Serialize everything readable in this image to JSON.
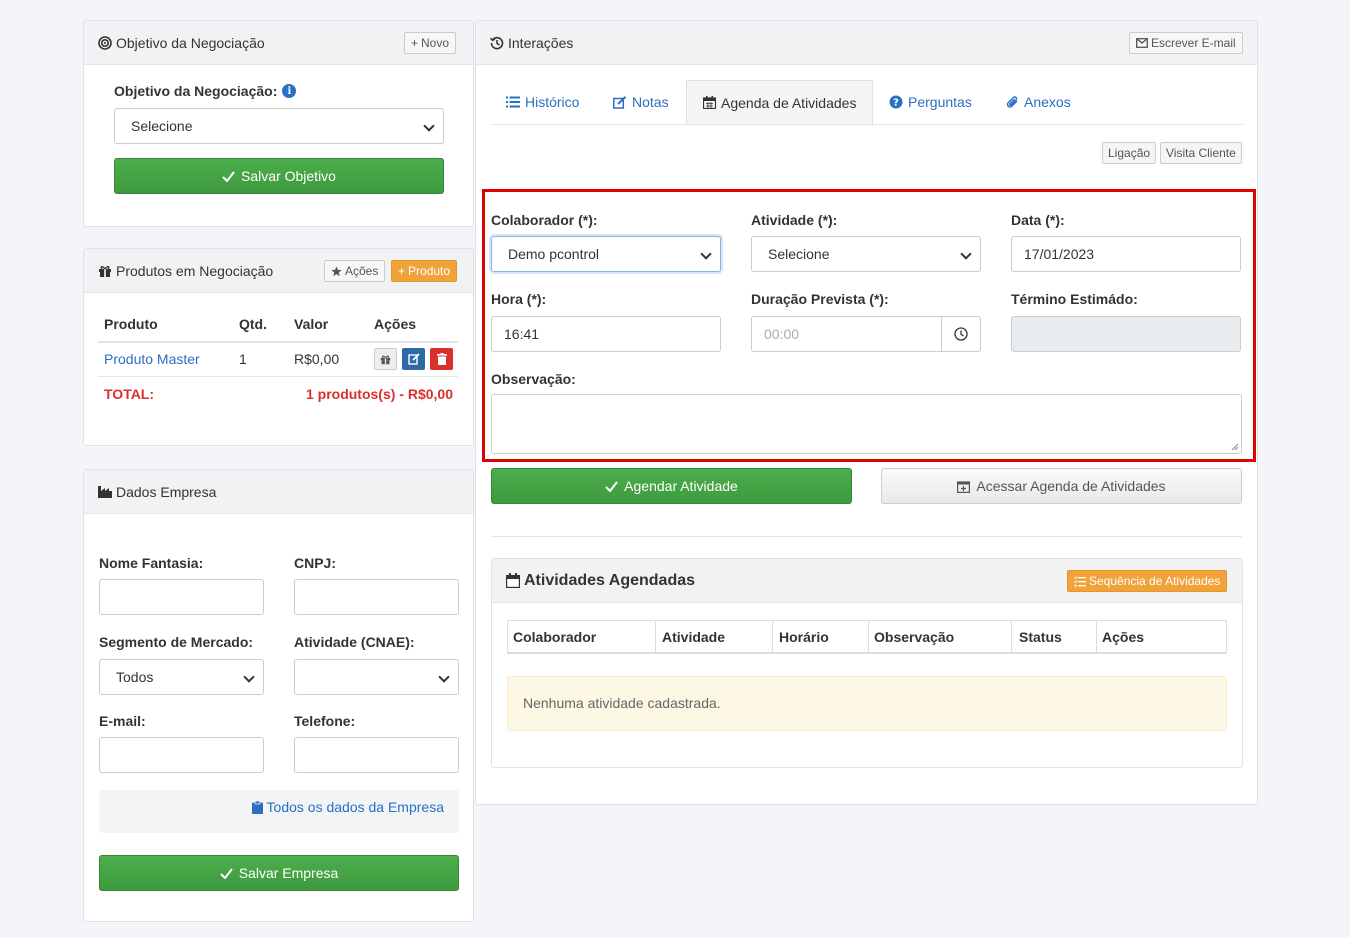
{
  "objetivo": {
    "title": "Objetivo da Negociação",
    "novo_label": "Novo",
    "field_label": "Objetivo da Negociação:",
    "select_value": "Selecione",
    "save_label": "Salvar Objetivo"
  },
  "produtos": {
    "title": "Produtos em Negociação",
    "acoes_label": "Ações",
    "produto_label": "Produto",
    "columns": [
      "Produto",
      "Qtd.",
      "Valor",
      "Ações"
    ],
    "rows": [
      {
        "produto": "Produto Master",
        "qtd": "1",
        "valor": "R$0,00"
      }
    ],
    "total_label": "TOTAL:",
    "total_value": "1 produtos(s) - R$0,00"
  },
  "empresa": {
    "title": "Dados Empresa",
    "nome_fantasia_label": "Nome Fantasia:",
    "cnpj_label": "CNPJ:",
    "segmento_label": "Segmento de Mercado:",
    "segmento_value": "Todos",
    "atividade_label": "Atividade (CNAE):",
    "email_label": "E-mail:",
    "telefone_label": "Telefone:",
    "todos_dados_link": "Todos os dados da Empresa",
    "save_label": "Salvar Empresa"
  },
  "interacoes": {
    "title": "Interações",
    "escrever_email": "Escrever E-mail",
    "tabs": [
      "Histórico",
      "Notas",
      "Agenda de Atividades",
      "Perguntas",
      "Anexos"
    ],
    "quick_buttons": [
      "Ligação",
      "Visita Cliente"
    ],
    "form": {
      "colaborador_label": "Colaborador (*):",
      "colaborador_value": "Demo pcontrol",
      "atividade_label": "Atividade (*):",
      "atividade_value": "Selecione",
      "data_label": "Data (*):",
      "data_value": "17/01/2023",
      "hora_label": "Hora (*):",
      "hora_value": "16:41",
      "duracao_label": "Duração Prevista (*):",
      "duracao_placeholder": "00:00",
      "termino_label": "Término Estimádo:",
      "observacao_label": "Observação:"
    },
    "agendar_label": "Agendar Atividade",
    "acessar_label": "Acessar Agenda de Atividades",
    "agendadas": {
      "title": "Atividades Agendadas",
      "sequencia_label": "Sequência de Atividades",
      "columns": [
        "Colaborador",
        "Atividade",
        "Horário",
        "Observação",
        "Status",
        "Ações"
      ],
      "empty_message": "Nenhuma atividade cadastrada."
    }
  },
  "colors": {
    "accent_link": "#2a6fc4",
    "success_green": "#43a443",
    "warning_orange": "#f0a23b",
    "danger_red": "#d9302c",
    "highlight_red": "#e00000"
  }
}
